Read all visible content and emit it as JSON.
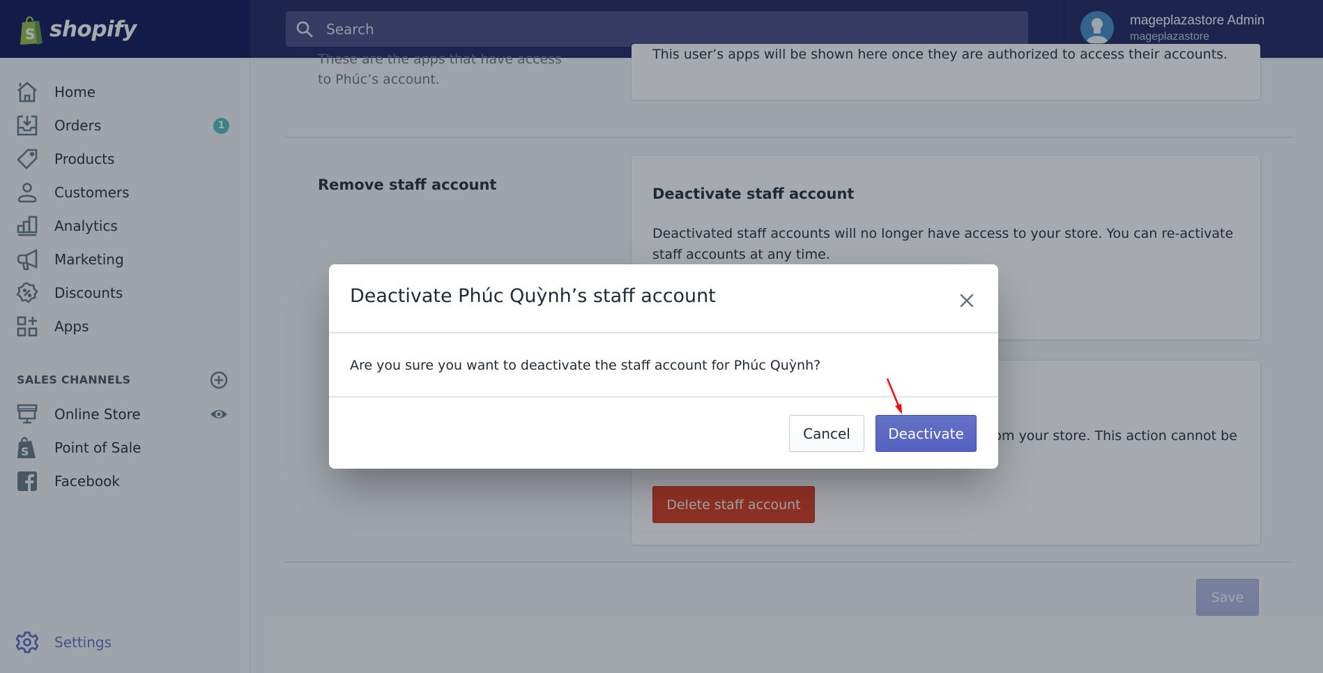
{
  "topbar": {
    "brand": "shopify",
    "search_placeholder": "Search",
    "user_name": "mageplazastore Admin",
    "store_name": "mageplazastore"
  },
  "sidebar": {
    "items": [
      {
        "label": "Home",
        "icon": "home-icon"
      },
      {
        "label": "Orders",
        "icon": "orders-icon",
        "badge": "1"
      },
      {
        "label": "Products",
        "icon": "tag-icon"
      },
      {
        "label": "Customers",
        "icon": "person-icon"
      },
      {
        "label": "Analytics",
        "icon": "bar-chart-icon"
      },
      {
        "label": "Marketing",
        "icon": "megaphone-icon"
      },
      {
        "label": "Discounts",
        "icon": "discount-icon"
      },
      {
        "label": "Apps",
        "icon": "apps-icon"
      }
    ],
    "sales_channels_title": "SALES CHANNELS",
    "channels": [
      {
        "label": "Online Store",
        "icon": "store-icon"
      },
      {
        "label": "Point of Sale",
        "icon": "shopify-bag-icon"
      },
      {
        "label": "Facebook",
        "icon": "facebook-icon"
      }
    ],
    "settings_label": "Settings"
  },
  "main": {
    "apps_section": {
      "description_line1": "These are the apps that have access",
      "description_line2": "to Phúc’s account.",
      "card_text": "This user’s apps will be shown here once they are authorized to access their accounts."
    },
    "remove_section": {
      "title": "Remove staff account",
      "deactivate_card": {
        "title": "Deactivate staff account",
        "text_line1": "Deactivated staff accounts will no longer have access to your store. You can re-activate",
        "text_line2": "staff accounts at any time."
      },
      "delete_card": {
        "text_visible": "rom your store. This action cannot be",
        "button_label": "Delete staff account"
      }
    },
    "save_label": "Save"
  },
  "modal": {
    "title": "Deactivate Phúc Quỳnh’s staff account",
    "body": "Are you sure you want to deactivate the staff account for Phúc Quỳnh?",
    "cancel_label": "Cancel",
    "confirm_label": "Deactivate"
  },
  "colors": {
    "brand_primary": "#5c6ac4",
    "destructive": "#de3618",
    "badge": "#47c1bf",
    "topbar": "#1c2260",
    "annotation_arrow": "#ff0000"
  }
}
